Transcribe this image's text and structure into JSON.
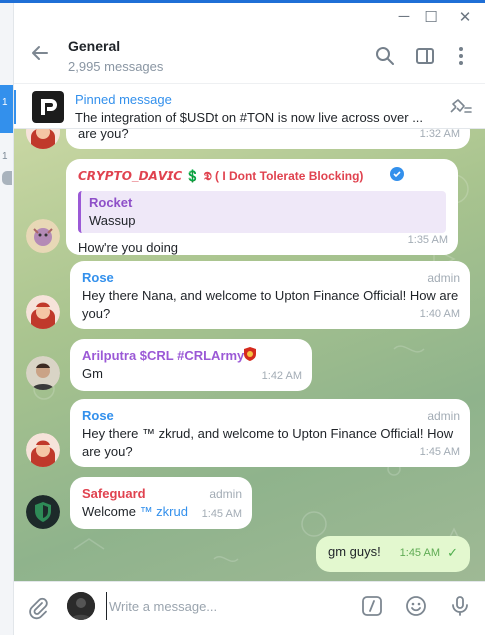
{
  "window": {
    "minimize": "─",
    "maximize": "☐",
    "close": "✕"
  },
  "left_rail": {
    "mark_top": "1",
    "mark_mid": "1"
  },
  "header": {
    "title": "General",
    "subtitle": "2,995 messages"
  },
  "pinned": {
    "label": "Pinned message",
    "text": "The integration of $USDt on #TON is now live across over ..."
  },
  "messages": [
    {
      "id": "m0",
      "text_tail": "are you?",
      "time": "1:32 AM"
    },
    {
      "id": "m1",
      "sender": "𝘾𝙍𝙔𝙋𝙏𝙊_𝘿𝘼𝙑𝙄𝘾 💲 𝕯 ( I Dont Tolerate Blocking)",
      "sender_color": "#e0424f",
      "reply_name": "Rocket",
      "reply_text": "Wassup",
      "text": "How're you doing",
      "time": "1:35 AM"
    },
    {
      "id": "m2",
      "sender": "Rose",
      "sender_color": "#3390ec",
      "role": "admin",
      "text": "Hey there Nana, and welcome to Upton Finance Official! How are you?",
      "time": "1:40 AM"
    },
    {
      "id": "m3",
      "sender": "Arilputra $CRL #CRLArmy",
      "sender_color": "#9b59d6",
      "text": "Gm",
      "time": "1:42 AM"
    },
    {
      "id": "m4",
      "sender": "Rose",
      "sender_color": "#3390ec",
      "role": "admin",
      "text": "Hey there ™ zkrud, and welcome to Upton Finance Official! How are you?",
      "time": "1:45 AM"
    },
    {
      "id": "m5",
      "sender": "Safeguard",
      "sender_color": "#e0424f",
      "role": "admin",
      "text_prefix": "Welcome ",
      "mention": "™ zkrud",
      "time": "1:45 AM"
    },
    {
      "id": "m6",
      "outgoing": true,
      "text": "gm guys!",
      "time": "1:45 AM",
      "status": "✓"
    }
  ],
  "composer": {
    "placeholder": "Write a message..."
  },
  "colors": {
    "accent": "#3390ec",
    "outgoing_bubble": "#e3f8cf",
    "read_check": "#4fae4e"
  },
  "icons": [
    "back-arrow-icon",
    "search-icon",
    "sidebar-toggle-icon",
    "more-vertical-icon",
    "pinned-list-icon",
    "attach-icon",
    "command-icon",
    "emoji-icon",
    "microphone-icon"
  ]
}
